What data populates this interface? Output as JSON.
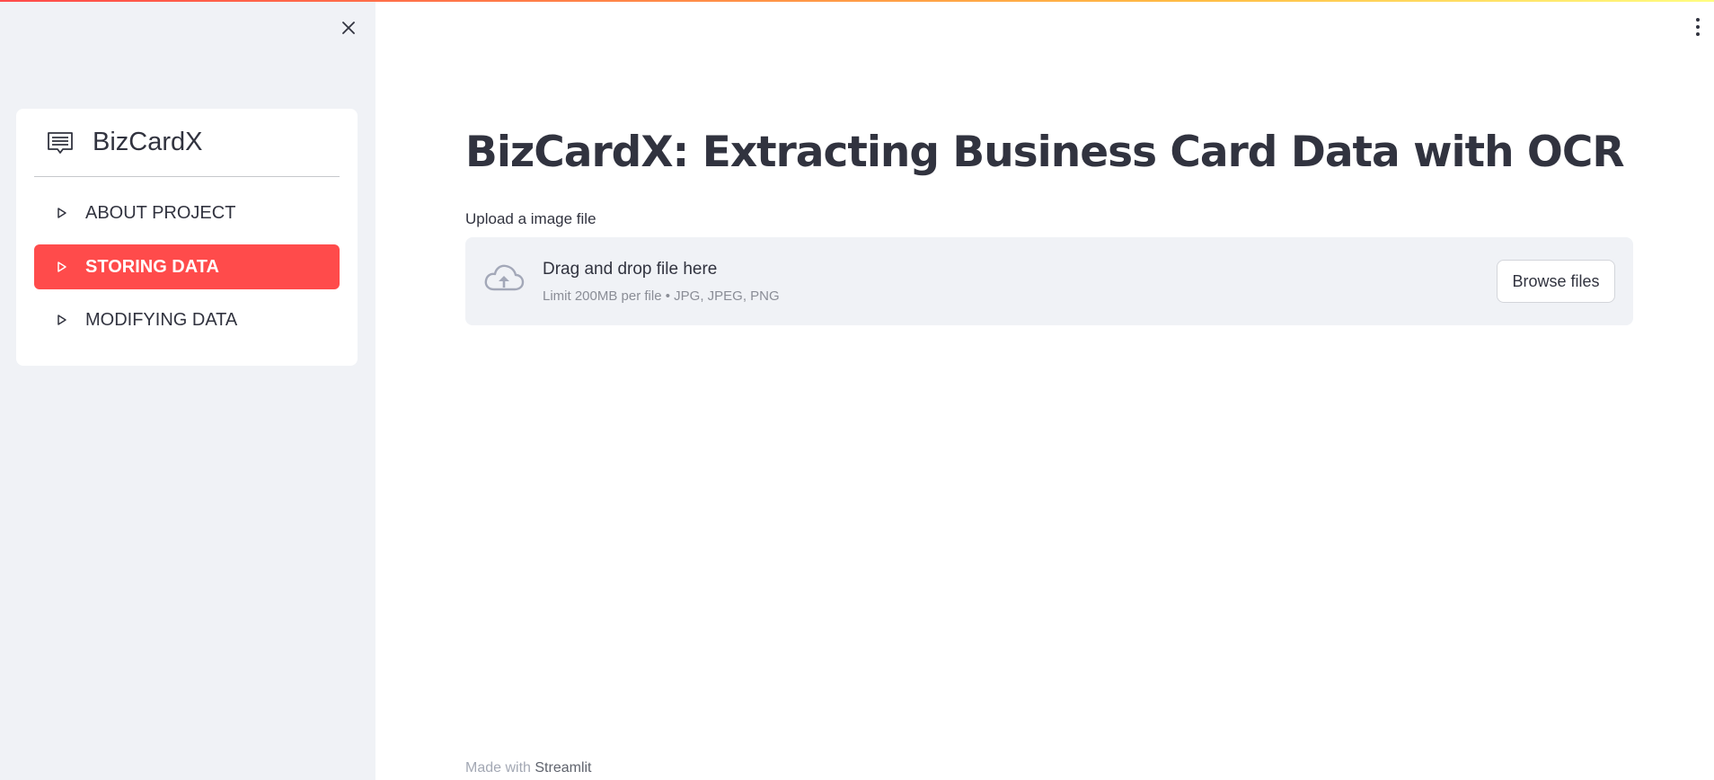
{
  "colors": {
    "accent": "#ff4b4b",
    "sidebar_bg": "#f0f2f6",
    "text": "#31333f",
    "muted_text": "#8a8d96"
  },
  "sidebar": {
    "close_icon": "close-icon",
    "menu": {
      "icon": "menu-card-icon",
      "title": "BizCardX",
      "items": [
        {
          "label": "ABOUT PROJECT",
          "icon": "play-outline-icon",
          "active": false
        },
        {
          "label": "STORING DATA",
          "icon": "play-outline-icon",
          "active": true
        },
        {
          "label": "MODIFYING DATA",
          "icon": "play-outline-icon",
          "active": false
        }
      ]
    }
  },
  "header": {
    "menu_icon": "kebab-menu-icon"
  },
  "main": {
    "title": "BizCardX: Extracting Business Card Data with OCR",
    "uploader": {
      "label": "Upload a image file",
      "icon": "cloud-upload-icon",
      "drop_text": "Drag and drop file here",
      "limit_text": "Limit 200MB per file • JPG, JPEG, PNG",
      "browse_label": "Browse files"
    }
  },
  "footer": {
    "prefix": "Made with",
    "brand": "Streamlit"
  }
}
